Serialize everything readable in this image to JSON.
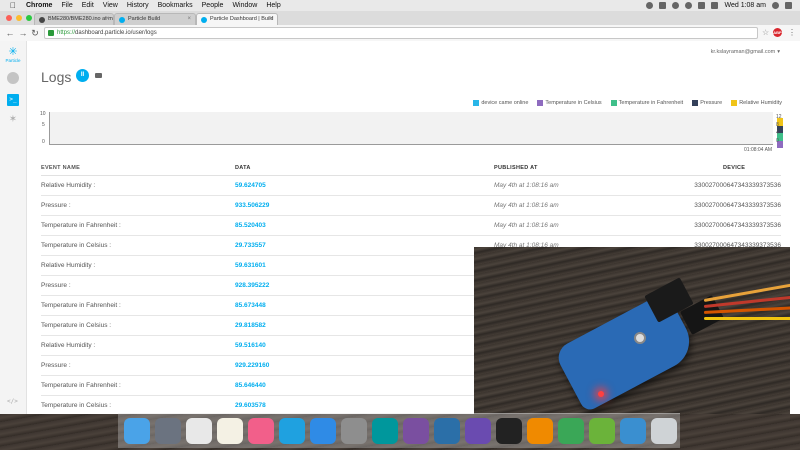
{
  "menubar": {
    "app_name": "Chrome",
    "menus": [
      "File",
      "Edit",
      "View",
      "History",
      "Bookmarks",
      "People",
      "Window",
      "Help"
    ],
    "clock": "Wed 1:08 am"
  },
  "browser": {
    "tabs": [
      {
        "title": "BME280/BME280.ino at m"
      },
      {
        "title": "Particle Build"
      },
      {
        "title": "Particle Dashboard | Build"
      }
    ],
    "url_scheme": "https://",
    "url_rest": "dashboard.particle.io/user/logs"
  },
  "sidebar": {
    "logo_label": "Particle"
  },
  "header": {
    "user_email": "kr.kslayraman@gmail.com",
    "page_title": "Logs"
  },
  "legend": [
    {
      "label": "device came online",
      "color": "#29b6e8"
    },
    {
      "label": "Temperature in Celsius",
      "color": "#8e6bbf"
    },
    {
      "label": "Temperature in Fahrenheit",
      "color": "#3fbf8a"
    },
    {
      "label": "Pressure",
      "color": "#34405a"
    },
    {
      "label": "Relative Humidity",
      "color": "#f0c419"
    }
  ],
  "chart_data": {
    "type": "bar",
    "categories": [
      "01:08:04 AM"
    ],
    "series": [
      {
        "name": "Relative Humidity",
        "values": [
          3
        ]
      },
      {
        "name": "Pressure",
        "values": [
          3
        ]
      },
      {
        "name": "Temperature in Fahrenheit",
        "values": [
          3
        ]
      },
      {
        "name": "Temperature in Celsius",
        "values": [
          3
        ]
      },
      {
        "name": "device came online",
        "values": [
          0
        ]
      }
    ],
    "yticks_left": [
      "10",
      "5",
      "0"
    ],
    "yticks_right": [
      "12",
      "8",
      "4",
      "0"
    ],
    "ylim": [
      0,
      12
    ]
  },
  "table": {
    "headers": {
      "event": "EVENT NAME",
      "data": "DATA",
      "published": "PUBLISHED AT",
      "device": "DEVICE"
    },
    "rows": [
      {
        "event": "Relative Humidity :",
        "data": "59.624705",
        "published": "May 4th at 1:08:16 am",
        "device": "330027000647343339373536"
      },
      {
        "event": "Pressure :",
        "data": "933.506229",
        "published": "May 4th at 1:08:16 am",
        "device": "330027000647343339373536"
      },
      {
        "event": "Temperature in Fahrenheit :",
        "data": "85.520403",
        "published": "May 4th at 1:08:16 am",
        "device": "330027000647343339373536"
      },
      {
        "event": "Temperature in Celsius :",
        "data": "29.733557",
        "published": "May 4th at 1:08:16 am",
        "device": "330027000647343339373536"
      },
      {
        "event": "Relative Humidity :",
        "data": "59.631601",
        "published": "",
        "device": ""
      },
      {
        "event": "Pressure :",
        "data": "928.395222",
        "published": "",
        "device": ""
      },
      {
        "event": "Temperature in Fahrenheit :",
        "data": "85.673448",
        "published": "",
        "device": ""
      },
      {
        "event": "Temperature in Celsius :",
        "data": "29.818582",
        "published": "",
        "device": ""
      },
      {
        "event": "Relative Humidity :",
        "data": "59.516140",
        "published": "",
        "device": ""
      },
      {
        "event": "Pressure :",
        "data": "929.229160",
        "published": "",
        "device": ""
      },
      {
        "event": "Temperature in Fahrenheit :",
        "data": "85.646440",
        "published": "",
        "device": ""
      },
      {
        "event": "Temperature in Celsius :",
        "data": "29.603578",
        "published": "",
        "device": ""
      }
    ]
  },
  "dock": {
    "apps": [
      {
        "name": "finder",
        "color": "#4aa3e8"
      },
      {
        "name": "launchpad",
        "color": "#6b7380"
      },
      {
        "name": "textedit",
        "color": "#e8e8e8"
      },
      {
        "name": "notes",
        "color": "#f4f1e4"
      },
      {
        "name": "itunes",
        "color": "#f25f8a"
      },
      {
        "name": "skype",
        "color": "#1fa1e0"
      },
      {
        "name": "app-store",
        "color": "#2f8be6"
      },
      {
        "name": "system-preferences",
        "color": "#8e8e8e"
      },
      {
        "name": "arduino",
        "color": "#00979c"
      },
      {
        "name": "github",
        "color": "#7a4fa0"
      },
      {
        "name": "quicktime",
        "color": "#2b6fa8"
      },
      {
        "name": "imovie",
        "color": "#6a4bb0"
      },
      {
        "name": "terminal",
        "color": "#222222"
      },
      {
        "name": "vlc",
        "color": "#f08a00"
      },
      {
        "name": "chrome",
        "color": "#3aa757"
      },
      {
        "name": "utorrent",
        "color": "#6bb33a"
      },
      {
        "name": "screen-capture",
        "color": "#3a8fd0"
      },
      {
        "name": "trash",
        "color": "#cfd3d6"
      }
    ]
  }
}
